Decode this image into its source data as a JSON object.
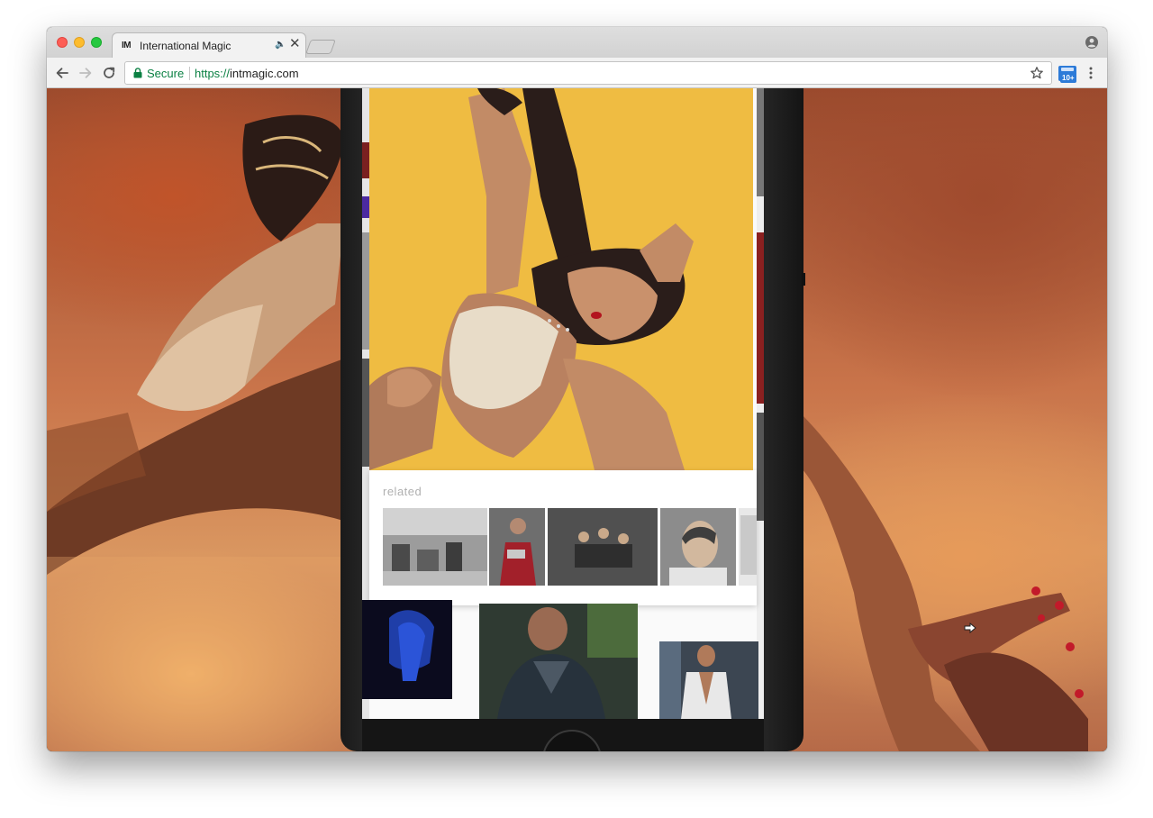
{
  "browser": {
    "tab": {
      "favicon_text": "IM",
      "title": "International Magic",
      "close_glyph": "✕",
      "audio_glyph": "🔈"
    },
    "omnibox": {
      "secure_label": "Secure",
      "url_scheme": "https://",
      "url_host": "intmagic.com"
    },
    "extension_badge": "10+",
    "icons": {
      "back": "back-arrow-icon",
      "forward": "forward-arrow-icon",
      "reload": "reload-icon",
      "lock": "lock-icon",
      "star": "star-icon",
      "profile": "profile-icon",
      "menu": "kebab-menu-icon"
    }
  },
  "page": {
    "related_heading": "related"
  },
  "colors": {
    "hero_background": "#efbc42",
    "secure_green": "#0b8043",
    "extension_blue": "#2d7bd8"
  }
}
